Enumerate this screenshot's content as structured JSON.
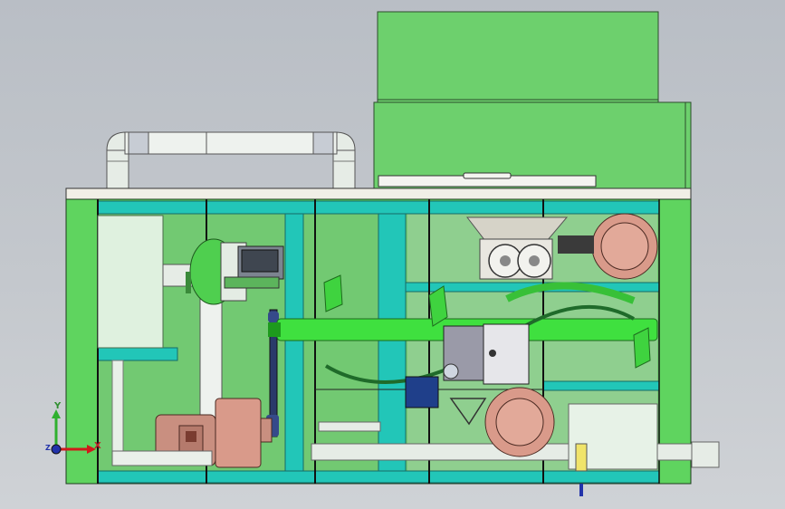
{
  "axis_triad": {
    "x_label": "X",
    "y_label": "Y",
    "z_label": "Z"
  },
  "colors": {
    "background": "#c4c8cd",
    "frame_green": "#5fd45f",
    "panel_green": "#6ccf6c",
    "teal": "#22c6b8",
    "pipe_white": "#e8eee8",
    "pipe_green": "#3fe03f",
    "motor_brown": "#d99a8a",
    "control_box": "#9a9aa8",
    "top_plate": "#f1efe6",
    "x_axis": "#d01a1a",
    "y_axis": "#2fb02f",
    "z_axis": "#2233aa"
  },
  "icons": {
    "axis_triad": "xyz-axis-icon"
  }
}
